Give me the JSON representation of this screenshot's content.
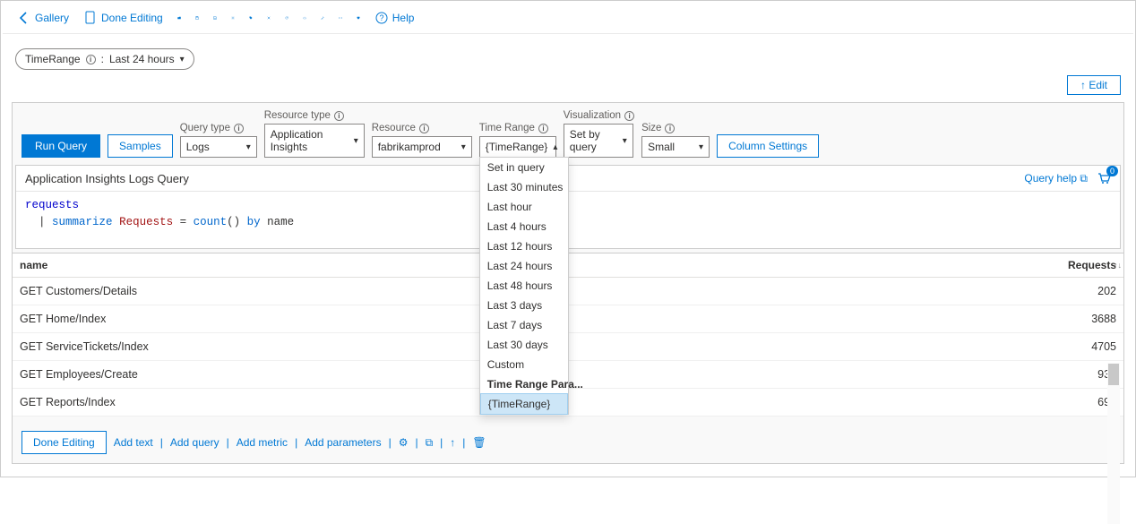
{
  "toolbar": {
    "gallery": "Gallery",
    "done_editing": "Done Editing",
    "help": "Help"
  },
  "param_pill": {
    "name": "TimeRange",
    "value": "Last 24 hours"
  },
  "edit_btn": "↑ Edit",
  "controls": {
    "run_query": "Run Query",
    "samples": "Samples",
    "query_type_label": "Query type",
    "query_type_value": "Logs",
    "resource_type_label": "Resource type",
    "resource_type_value": "Application Insights",
    "resource_label": "Resource",
    "resource_value": "fabrikamprod",
    "time_range_label": "Time Range",
    "time_range_value": "{TimeRange}",
    "visualization_label": "Visualization",
    "visualization_value": "Set by query",
    "size_label": "Size",
    "size_value": "Small",
    "column_settings": "Column Settings"
  },
  "time_range_options": [
    {
      "label": "Set in query",
      "selected": false,
      "bold": false
    },
    {
      "label": "Last 30 minutes",
      "selected": false,
      "bold": false
    },
    {
      "label": "Last hour",
      "selected": false,
      "bold": false
    },
    {
      "label": "Last 4 hours",
      "selected": false,
      "bold": false
    },
    {
      "label": "Last 12 hours",
      "selected": false,
      "bold": false
    },
    {
      "label": "Last 24 hours",
      "selected": false,
      "bold": false
    },
    {
      "label": "Last 48 hours",
      "selected": false,
      "bold": false
    },
    {
      "label": "Last 3 days",
      "selected": false,
      "bold": false
    },
    {
      "label": "Last 7 days",
      "selected": false,
      "bold": false
    },
    {
      "label": "Last 30 days",
      "selected": false,
      "bold": false
    },
    {
      "label": "Custom",
      "selected": false,
      "bold": false
    },
    {
      "label": "Time Range Para...",
      "selected": false,
      "bold": true
    },
    {
      "label": "   {TimeRange}",
      "selected": true,
      "bold": false
    }
  ],
  "query_area": {
    "title": "Application Insights Logs Query",
    "help_link": "Query help",
    "notif_count": "0",
    "code_line1": "requests",
    "code_pipe": "|",
    "code_summarize": "summarize",
    "code_ident": "Requests",
    "code_eq": " = ",
    "code_count": "count",
    "code_paren": "()",
    "code_by": "by",
    "code_name": " name"
  },
  "table": {
    "columns": {
      "name": "name",
      "requests": "Requests"
    },
    "rows": [
      {
        "name": "GET Customers/Details",
        "requests": "202"
      },
      {
        "name": "GET Home/Index",
        "requests": "3688"
      },
      {
        "name": "GET ServiceTickets/Index",
        "requests": "4705"
      },
      {
        "name": "GET Employees/Create",
        "requests": "937"
      },
      {
        "name": "GET Reports/Index",
        "requests": "690"
      }
    ]
  },
  "footer": {
    "done_editing": "Done Editing",
    "add_text": "Add text",
    "add_query": "Add query",
    "add_metric": "Add metric",
    "add_parameters": "Add parameters"
  }
}
